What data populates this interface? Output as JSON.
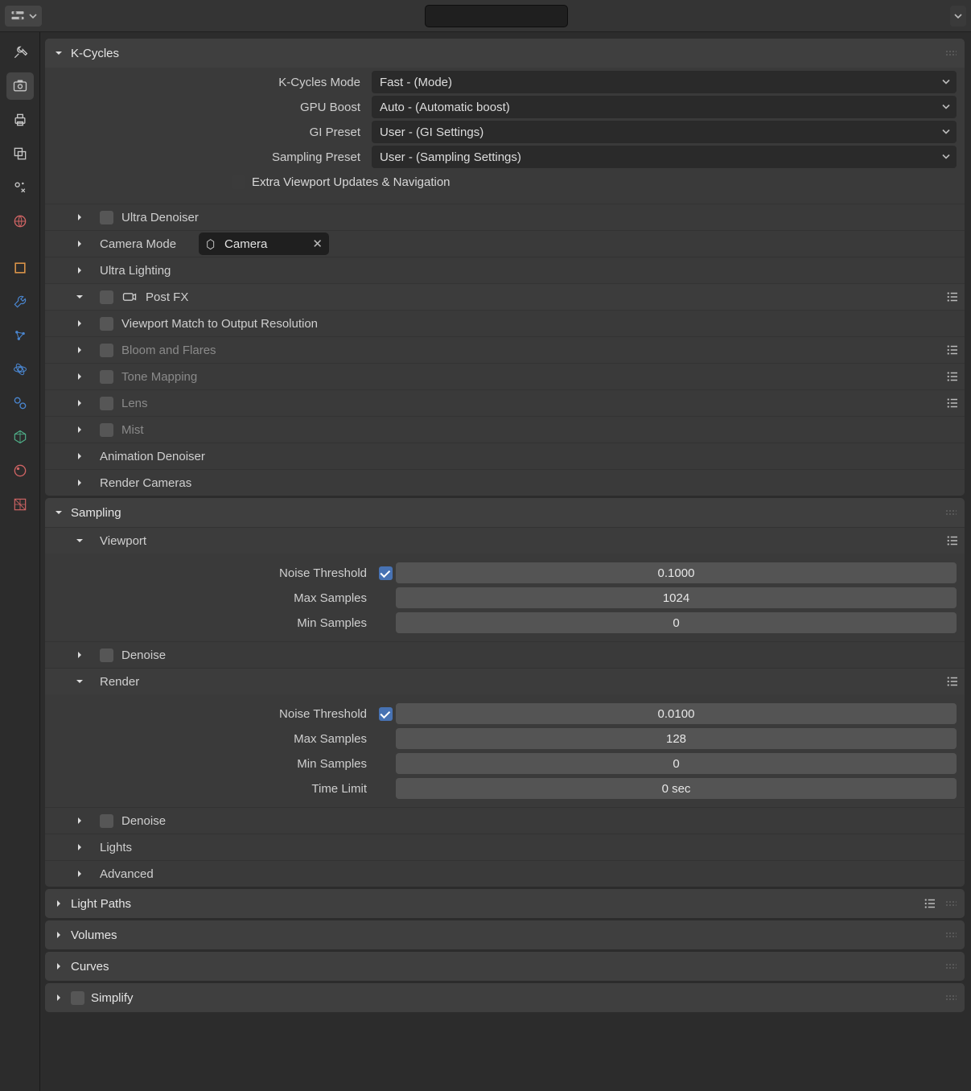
{
  "header": {
    "search_placeholder": ""
  },
  "tabs": {
    "items": [
      {
        "name": "tool-tab",
        "color": "#c6c6c6"
      },
      {
        "name": "render-tab",
        "color": "#c6c6c6",
        "active": true
      },
      {
        "name": "output-tab",
        "color": "#c6c6c6"
      },
      {
        "name": "viewlayer-tab",
        "color": "#c6c6c6"
      },
      {
        "name": "scene-tab",
        "color": "#c6c6c6"
      },
      {
        "name": "world-tab",
        "color": "#d06464"
      },
      {
        "name": "object-tab",
        "color": "#e49a4a"
      },
      {
        "name": "modifier-tab",
        "color": "#4a86d0"
      },
      {
        "name": "particle-tab",
        "color": "#4a86d0"
      },
      {
        "name": "physics-tab",
        "color": "#4a86d0"
      },
      {
        "name": "constraint-tab",
        "color": "#4a86d0"
      },
      {
        "name": "data-tab",
        "color": "#4fb089"
      },
      {
        "name": "material-tab",
        "color": "#d06464"
      },
      {
        "name": "texture-tab",
        "color": "#d06464"
      }
    ]
  },
  "kcycles": {
    "title": "K-Cycles",
    "mode": {
      "label": "K-Cycles Mode",
      "value": "Fast - (Mode)"
    },
    "gpu_boost": {
      "label": "GPU Boost",
      "value": "Auto - (Automatic boost)"
    },
    "gi_preset": {
      "label": "GI Preset",
      "value": "User - (GI Settings)"
    },
    "sampling_preset": {
      "label": "Sampling Preset",
      "value": "User - (Sampling Settings)"
    },
    "extra_vp": {
      "label": "Extra Viewport Updates & Navigation",
      "checked": false
    },
    "subpanels": {
      "ultra_denoiser": "Ultra Denoiser",
      "camera_mode": {
        "label": "Camera Mode",
        "chip": "Camera"
      },
      "ultra_lighting": "Ultra Lighting",
      "post_fx": "Post FX",
      "viewport_match": "Viewport Match to Output Resolution",
      "bloom": "Bloom and Flares",
      "tone": "Tone Mapping",
      "lens": "Lens",
      "mist": "Mist",
      "anim_denoiser": "Animation Denoiser",
      "render_cameras": "Render Cameras"
    }
  },
  "sampling": {
    "title": "Sampling",
    "viewport": {
      "title": "Viewport",
      "noise_threshold": {
        "label": "Noise Threshold",
        "checked": true,
        "value": "0.1000"
      },
      "max_samples": {
        "label": "Max Samples",
        "value": "1024"
      },
      "min_samples": {
        "label": "Min Samples",
        "value": "0"
      },
      "denoise": {
        "label": "Denoise"
      }
    },
    "render": {
      "title": "Render",
      "noise_threshold": {
        "label": "Noise Threshold",
        "checked": true,
        "value": "0.0100"
      },
      "max_samples": {
        "label": "Max Samples",
        "value": "128"
      },
      "min_samples": {
        "label": "Min Samples",
        "value": "0"
      },
      "time_limit": {
        "label": "Time Limit",
        "value": "0 sec"
      },
      "denoise": {
        "label": "Denoise"
      }
    },
    "lights": "Lights",
    "advanced": "Advanced"
  },
  "panels_bottom": {
    "light_paths": "Light Paths",
    "volumes": "Volumes",
    "curves": "Curves",
    "simplify": "Simplify"
  }
}
